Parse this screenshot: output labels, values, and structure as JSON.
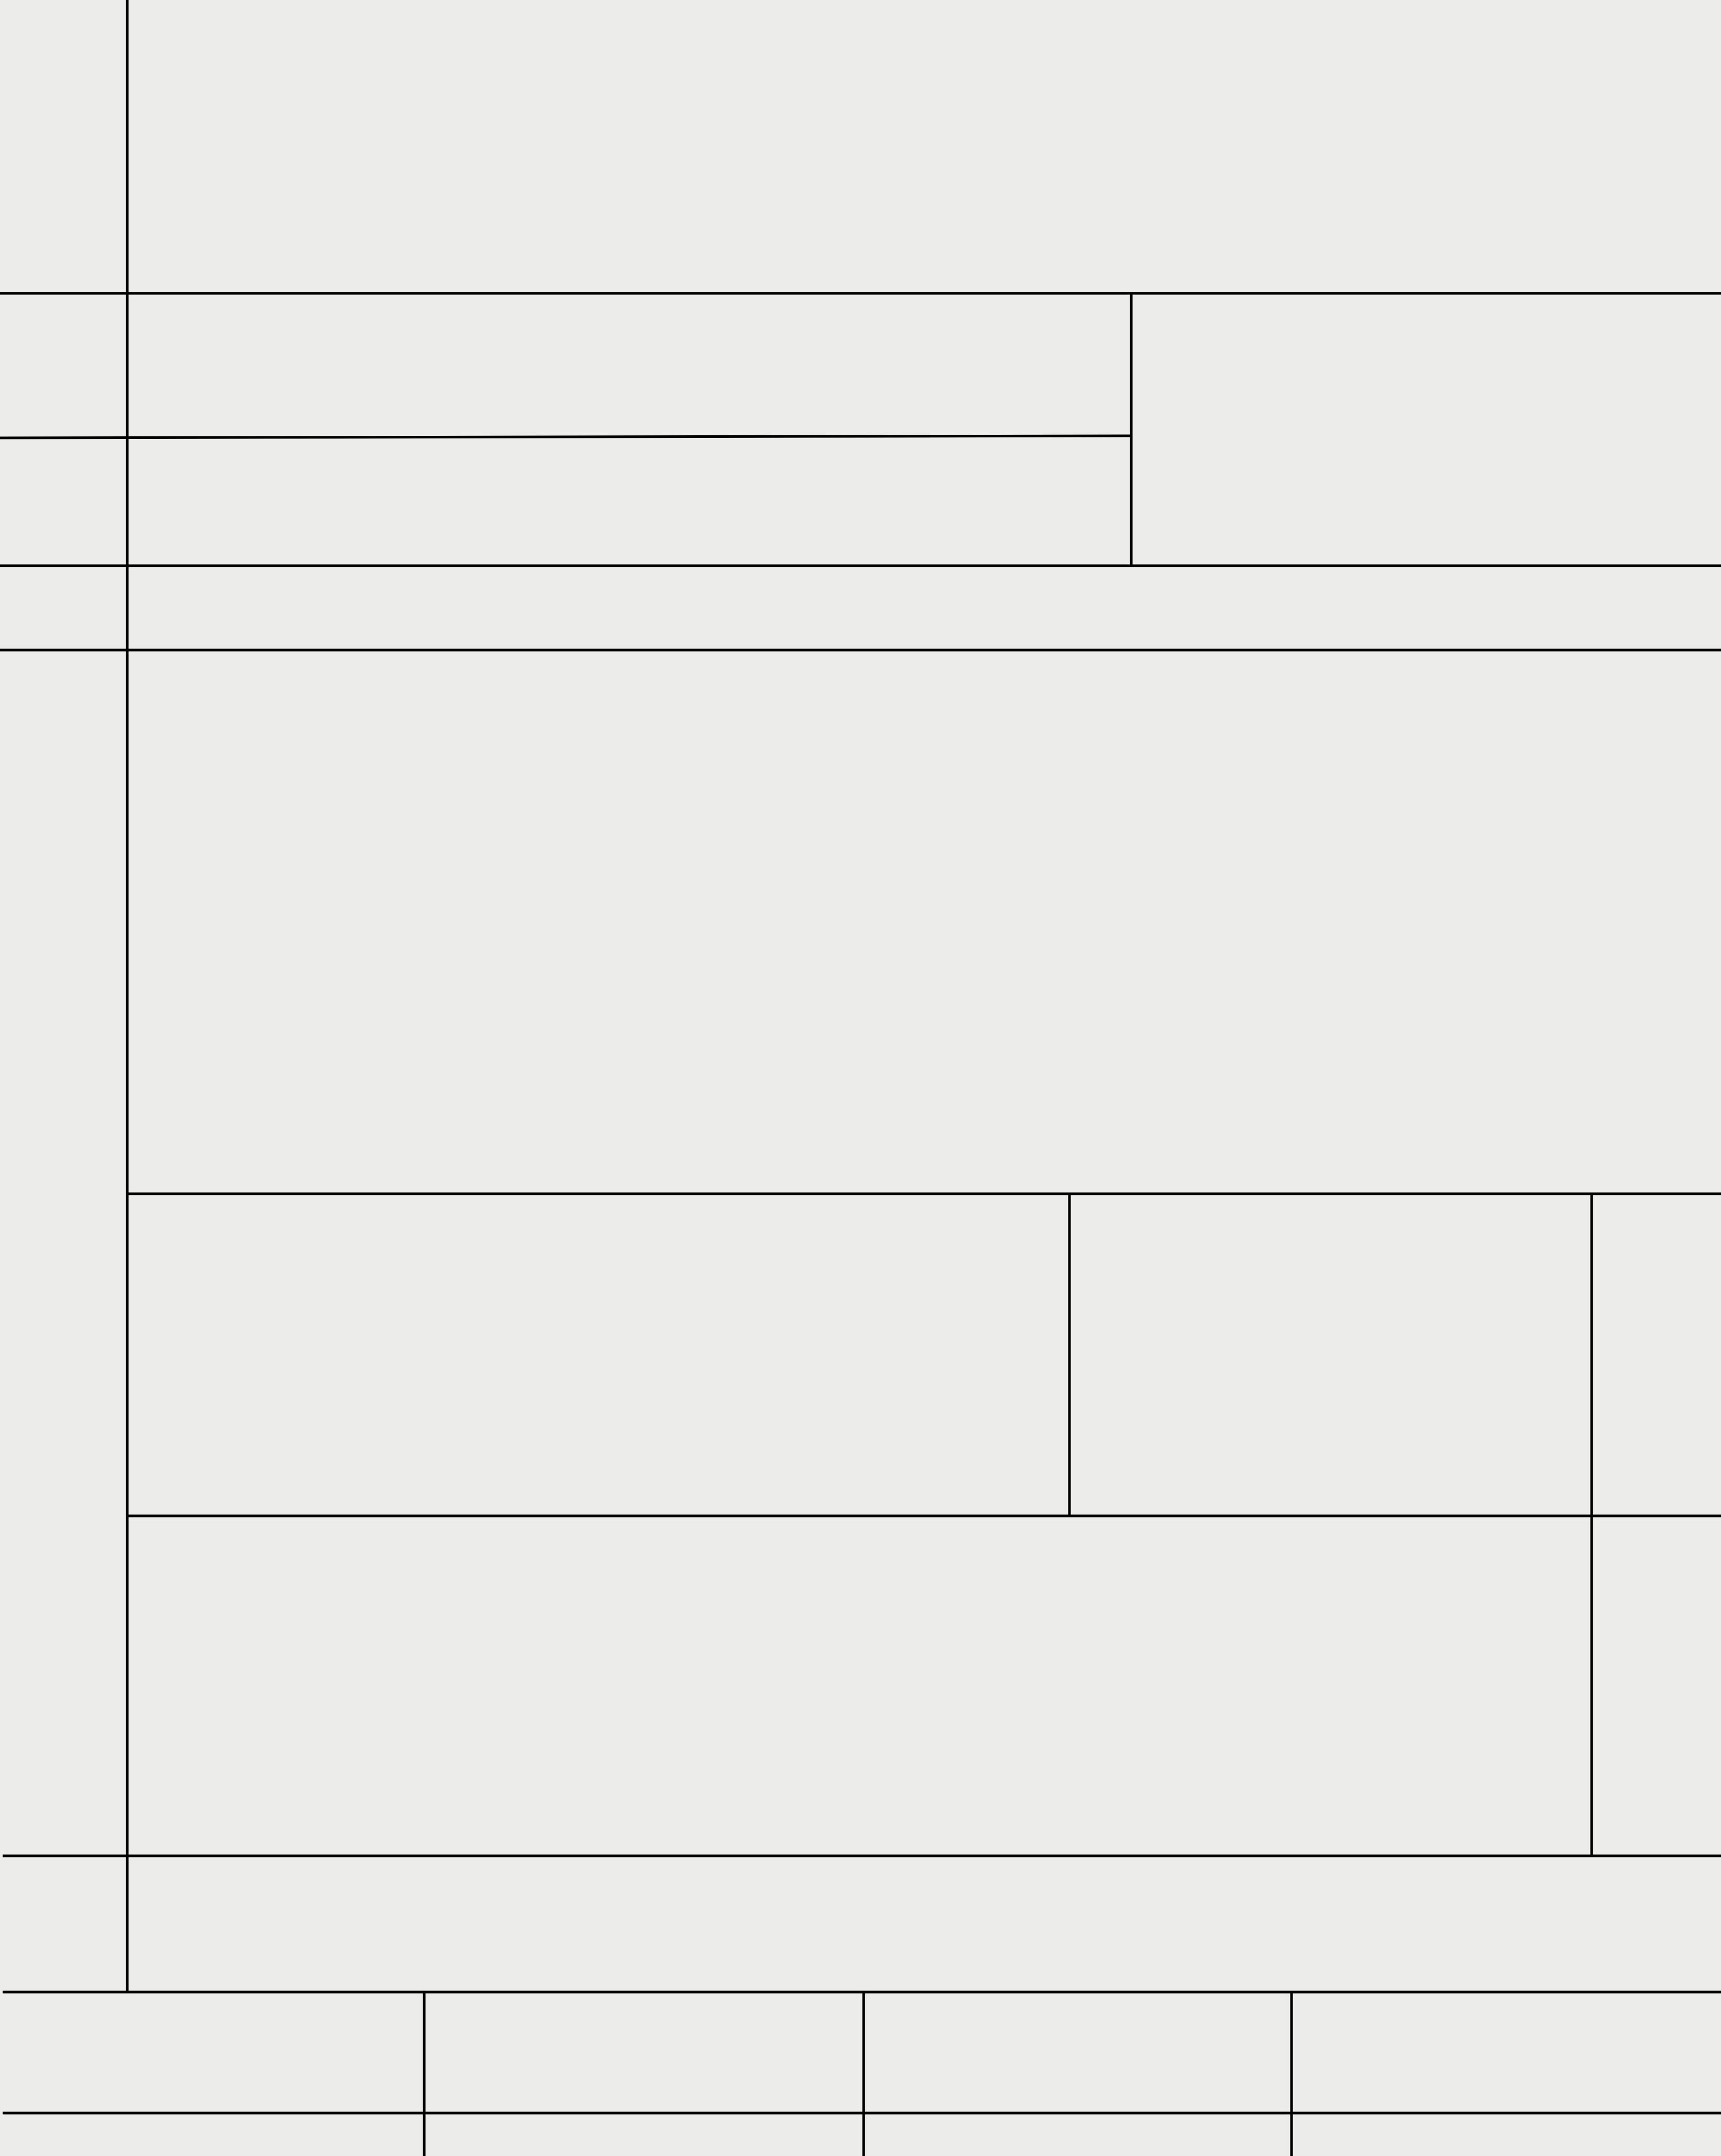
{
  "page": {
    "background_color": "#ececea",
    "line_color": "#000000",
    "content": "no visible text"
  }
}
